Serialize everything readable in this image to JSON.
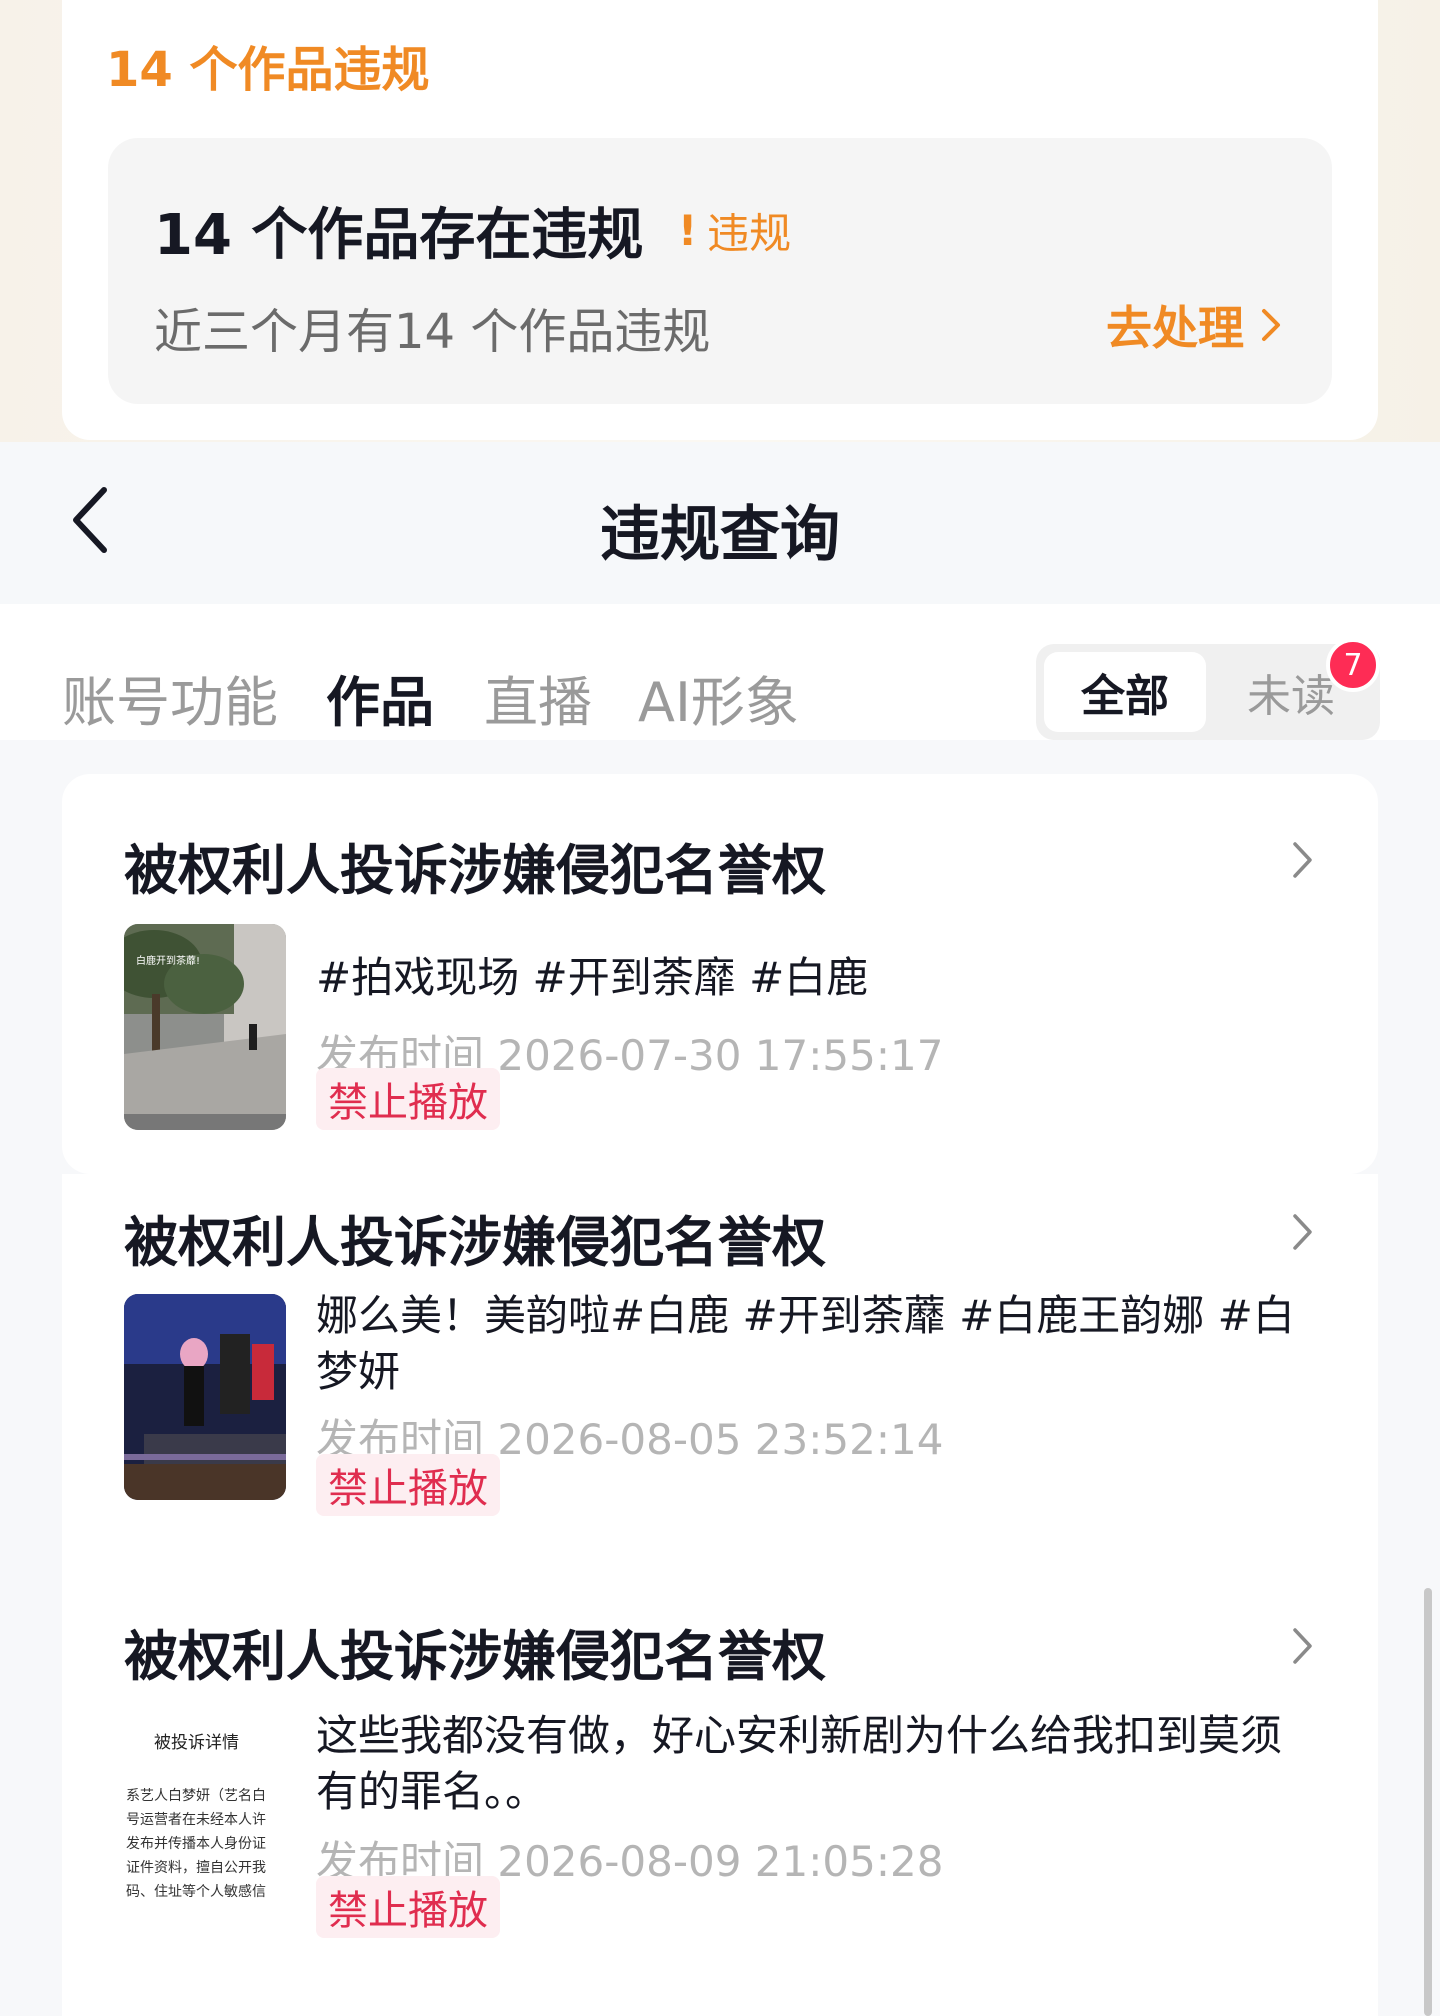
{
  "summary": {
    "header": "14 个作品违规",
    "card_title": "14 个作品存在违规",
    "badge_label": "违规",
    "subtitle": "近三个月有14 个作品违规",
    "action_label": "去处理"
  },
  "nav": {
    "title": "违规查询"
  },
  "tabs": [
    {
      "label": "账号功能",
      "active": false
    },
    {
      "label": "作品",
      "active": true
    },
    {
      "label": "直播",
      "active": false
    },
    {
      "label": "AI形象",
      "active": false
    }
  ],
  "filter": {
    "all_label": "全部",
    "unread_label": "未读",
    "unread_count": "7"
  },
  "items": [
    {
      "title": "被权利人投诉涉嫌侵犯名誉权",
      "description": "#拍戏现场 #开到荼靡 #白鹿",
      "time": "发布时间 2026-07-30 17:55:17",
      "status": "禁止播放",
      "thumb_caption": "白鹿开到茶蘼!"
    },
    {
      "title": "被权利人投诉涉嫌侵犯名誉权",
      "description": "娜么美！美韵啦#白鹿 #开到荼蘼 #白鹿王韵娜 #白梦妍",
      "time": "发布时间 2026-08-05 23:52:14",
      "status": "禁止播放"
    },
    {
      "title": "被权利人投诉涉嫌侵犯名誉权",
      "description": "这些我都没有做，好心安利新剧为什么给我扣到莫须有的罪名。。",
      "time": "发布时间 2026-08-09 21:05:28",
      "status": "禁止播放",
      "thumb_heading": "被投诉详情",
      "thumb_lines": [
        "系艺人白梦妍（艺名白",
        "号运营者在未经本人许",
        "发布并传播本人身份证",
        "证件资料，擅自公开我",
        "码、住址等个人敏感信"
      ]
    }
  ],
  "colors": {
    "accent_orange": "#f08a24",
    "danger_red": "#fe2c55",
    "status_text": "#e02d4f"
  }
}
